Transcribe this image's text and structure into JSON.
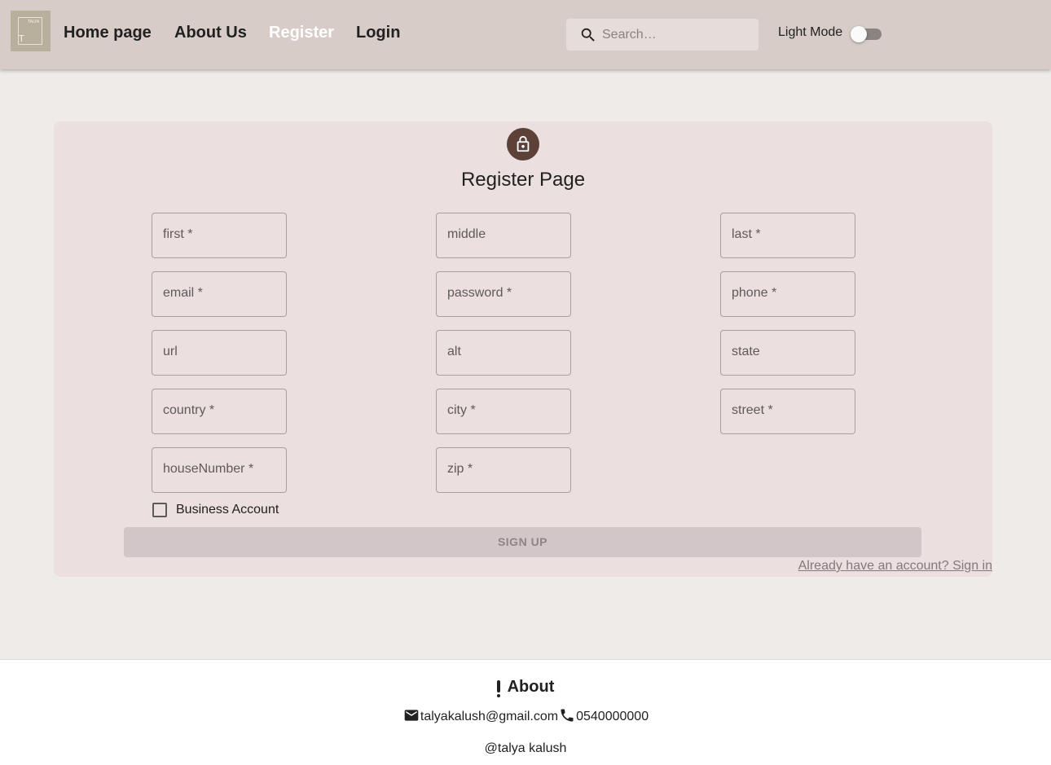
{
  "header": {
    "logo": {
      "top_text": "TALYA",
      "letter": "T"
    },
    "nav": [
      {
        "label": "Home page"
      },
      {
        "label": "About Us"
      },
      {
        "label": "Register",
        "active": true
      },
      {
        "label": "Login"
      }
    ],
    "search": {
      "placeholder": "Search…"
    },
    "mode_label": "Light Mode",
    "mode_toggle_on": false
  },
  "register": {
    "title": "Register Page",
    "fields": [
      {
        "label": "first *"
      },
      {
        "label": "middle"
      },
      {
        "label": "last *"
      },
      {
        "label": "email *"
      },
      {
        "label": "password *"
      },
      {
        "label": "phone *"
      },
      {
        "label": "url"
      },
      {
        "label": "alt"
      },
      {
        "label": "state"
      },
      {
        "label": "country *"
      },
      {
        "label": "city *"
      },
      {
        "label": "street *"
      },
      {
        "label": "houseNumber *"
      },
      {
        "label": "zip *"
      }
    ],
    "business_label": "Business Account",
    "business_checked": false,
    "signup_label": "SIGN UP",
    "signin_link": "Already have an account? Sign in"
  },
  "footer": {
    "about_label": "About",
    "email": "talyakalush@gmail.com",
    "phone": "0540000000",
    "credit": "@talya kalush"
  },
  "colors": {
    "appbar": "#d7ccc8",
    "page": "#efebe9",
    "card": "#ebdfe0",
    "avatar": "#5d4037"
  }
}
